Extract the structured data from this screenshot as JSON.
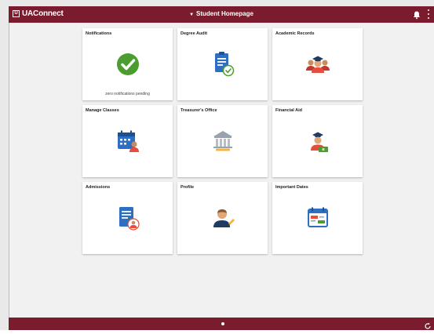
{
  "header": {
    "brand_logo": "U",
    "brand": "UAConnect",
    "title": "Student Homepage",
    "bell_icon": "bell-icon",
    "menu_icon": "kebab-menu-icon"
  },
  "tiles": [
    {
      "title": "Notifications",
      "icon": "check-circle-icon",
      "subtitle": "zero notifications pending"
    },
    {
      "title": "Degree Audit",
      "icon": "clipboard-check-icon"
    },
    {
      "title": "Academic Records",
      "icon": "graduates-icon"
    },
    {
      "title": "Manage Classes",
      "icon": "calendar-person-icon"
    },
    {
      "title": "Treasurer's Office",
      "icon": "bank-building-icon"
    },
    {
      "title": "Financial Aid",
      "icon": "graduate-money-icon"
    },
    {
      "title": "Admissions",
      "icon": "document-person-icon"
    },
    {
      "title": "Profile",
      "icon": "user-edit-icon"
    },
    {
      "title": "Important Dates",
      "icon": "calendar-events-icon"
    }
  ],
  "footer": {
    "indicator_icon": "page-dot-icon",
    "refresh_icon": "refresh-icon"
  },
  "colors": {
    "brand_bar": "#7a1c2e",
    "background": "#f1f1f1",
    "tile_bg": "#ffffff",
    "check_green": "#4a9d2e",
    "icon_blue": "#2f6fc1"
  }
}
